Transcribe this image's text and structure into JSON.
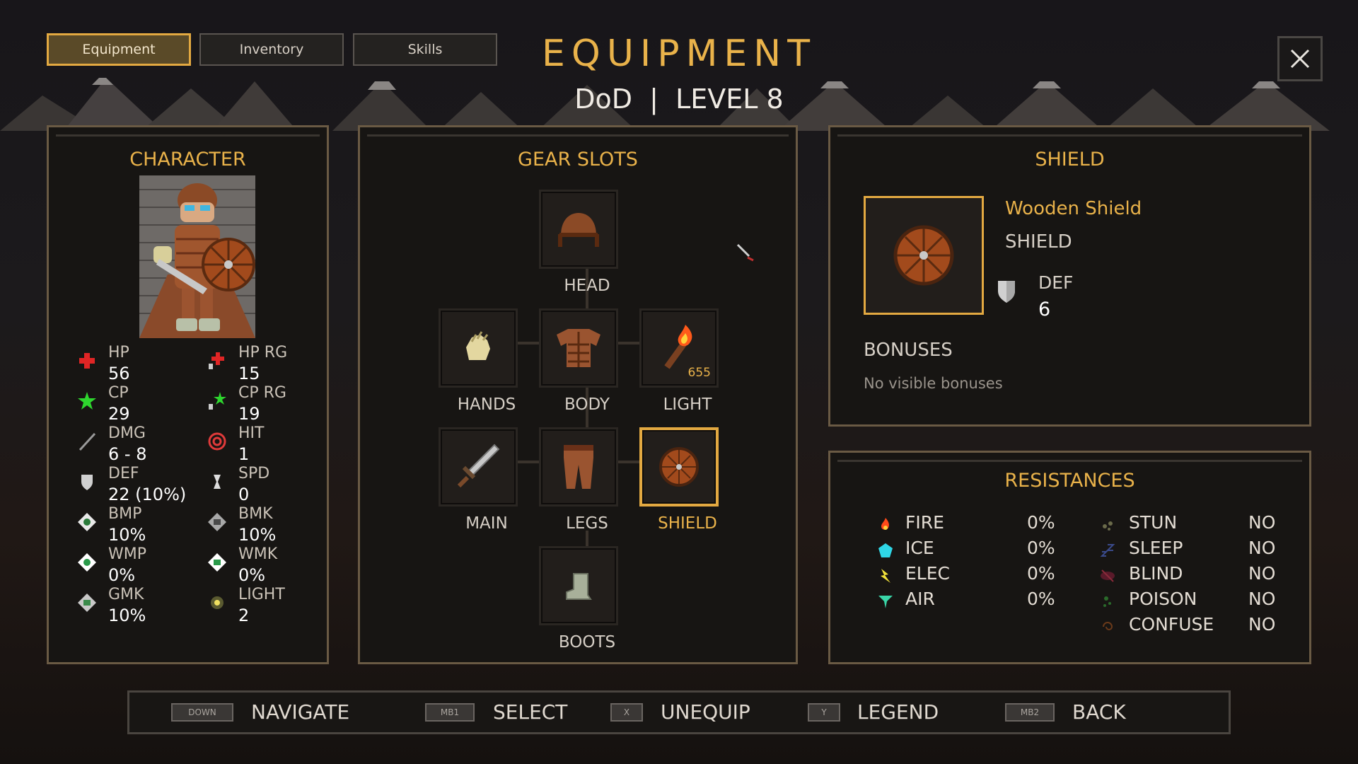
{
  "tabs": [
    {
      "label": "Equipment",
      "active": true
    },
    {
      "label": "Inventory",
      "active": false
    },
    {
      "label": "Skills",
      "active": false
    }
  ],
  "header": {
    "title": "EQUIPMENT",
    "subtitle": "DoD  |  LEVEL 8"
  },
  "character": {
    "title": "CHARACTER",
    "stats": [
      {
        "icon": "hp-cross-icon",
        "label": "HP",
        "value": "56"
      },
      {
        "icon": "hp-regen-icon",
        "label": "HP RG",
        "value": "15"
      },
      {
        "icon": "cp-star-icon",
        "label": "CP",
        "value": "29"
      },
      {
        "icon": "cp-regen-icon",
        "label": "CP RG",
        "value": "19"
      },
      {
        "icon": "damage-sword-icon",
        "label": "DMG",
        "value": "6 - 8"
      },
      {
        "icon": "hit-target-icon",
        "label": "HIT",
        "value": "1"
      },
      {
        "icon": "defense-shield-icon",
        "label": "DEF",
        "value": "22 (10%)"
      },
      {
        "icon": "speed-hourglass-icon",
        "label": "SPD",
        "value": "0"
      },
      {
        "icon": "bmp-gem-icon",
        "label": "BMP",
        "value": "10%"
      },
      {
        "icon": "bmk-gem-icon",
        "label": "BMK",
        "value": "10%"
      },
      {
        "icon": "wmp-gem-icon",
        "label": "WMP",
        "value": "0%"
      },
      {
        "icon": "wmk-gem-icon",
        "label": "WMK",
        "value": "0%"
      },
      {
        "icon": "gmk-gem-icon",
        "label": "GMK",
        "value": "10%"
      },
      {
        "icon": "light-orb-icon",
        "label": "LIGHT",
        "value": "2"
      }
    ]
  },
  "gear": {
    "title": "GEAR SLOTS",
    "slots": [
      {
        "label": "HEAD",
        "icon": "helmet-icon"
      },
      {
        "label": "HANDS",
        "icon": "gloves-icon"
      },
      {
        "label": "BODY",
        "icon": "body-armor-icon"
      },
      {
        "label": "LIGHT",
        "icon": "torch-icon",
        "count": "655"
      },
      {
        "label": "MAIN",
        "icon": "sword-icon"
      },
      {
        "label": "LEGS",
        "icon": "leg-armor-icon"
      },
      {
        "label": "SHIELD",
        "icon": "wooden-shield-icon",
        "selected": true
      },
      {
        "label": "BOOTS",
        "icon": "boots-icon"
      }
    ]
  },
  "detail": {
    "title": "SHIELD",
    "item_name": "Wooden Shield",
    "item_type": "SHIELD",
    "stat_label": "DEF",
    "stat_value": "6",
    "bonuses_title": "BONUSES",
    "bonuses_text": "No visible bonuses"
  },
  "resistances": {
    "title": "RESISTANCES",
    "elements": [
      {
        "icon": "fire-icon",
        "label": "FIRE",
        "value": "0%"
      },
      {
        "icon": "ice-icon",
        "label": "ICE",
        "value": "0%"
      },
      {
        "icon": "elec-icon",
        "label": "ELEC",
        "value": "0%"
      },
      {
        "icon": "air-icon",
        "label": "AIR",
        "value": "0%"
      }
    ],
    "statuses": [
      {
        "icon": "stun-icon",
        "label": "STUN",
        "value": "NO"
      },
      {
        "icon": "sleep-icon",
        "label": "SLEEP",
        "value": "NO"
      },
      {
        "icon": "blind-icon",
        "label": "BLIND",
        "value": "NO"
      },
      {
        "icon": "poison-icon",
        "label": "POISON",
        "value": "NO"
      },
      {
        "icon": "confuse-icon",
        "label": "CONFUSE",
        "value": "NO"
      }
    ]
  },
  "controls": [
    {
      "key": "DOWN",
      "label": "NAVIGATE"
    },
    {
      "key": "MB1",
      "label": "SELECT"
    },
    {
      "key": "X",
      "label": "UNEQUIP"
    },
    {
      "key": "Y",
      "label": "LEGEND"
    },
    {
      "key": "MB2",
      "label": "BACK"
    }
  ],
  "colors": {
    "accent": "#e9b24a",
    "panel_border": "#6a5a44",
    "background": "#141210"
  }
}
